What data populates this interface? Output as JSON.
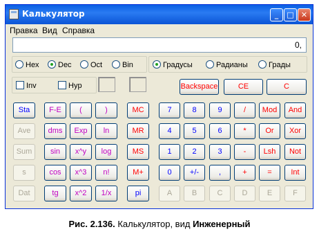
{
  "window": {
    "title": "Калькулятор"
  },
  "menu": [
    "Правка",
    "Вид",
    "Справка"
  ],
  "display": {
    "value": "0,"
  },
  "number_system": {
    "options": [
      "Hex",
      "Dec",
      "Oct",
      "Bin"
    ],
    "selected": "Dec"
  },
  "angle_units": {
    "options": [
      "Градусы",
      "Радианы",
      "Грады"
    ],
    "selected": "Градусы"
  },
  "checkboxes": [
    "Inv",
    "Hyp"
  ],
  "top_buttons": [
    "Backspace",
    "CE",
    "C"
  ],
  "stat_buttons": [
    "Sta",
    "Ave",
    "Sum",
    "s",
    "Dat"
  ],
  "sci_buttons": {
    "col1": [
      "F-E",
      "dms",
      "sin",
      "cos",
      "tg"
    ],
    "col2": [
      "(",
      "Exp",
      "x^y",
      "x^3",
      "x^2"
    ],
    "col3": [
      ")",
      "ln",
      "log",
      "n!",
      "1/x"
    ]
  },
  "memory_buttons": [
    "MC",
    "MR",
    "MS",
    "M+",
    "pi"
  ],
  "digit_rows": [
    [
      "7",
      "8",
      "9",
      "/",
      "Mod",
      "And"
    ],
    [
      "4",
      "5",
      "6",
      "*",
      "Or",
      "Xor"
    ],
    [
      "1",
      "2",
      "3",
      "-",
      "Lsh",
      "Not"
    ],
    [
      "0",
      "+/-",
      ",",
      "+",
      "=",
      "Int"
    ],
    [
      "A",
      "B",
      "C",
      "D",
      "E",
      "F"
    ]
  ],
  "caption": {
    "prefix": "Рис. 2.136.",
    "text": "Калькулятор, вид",
    "bold": "Инженерный"
  }
}
